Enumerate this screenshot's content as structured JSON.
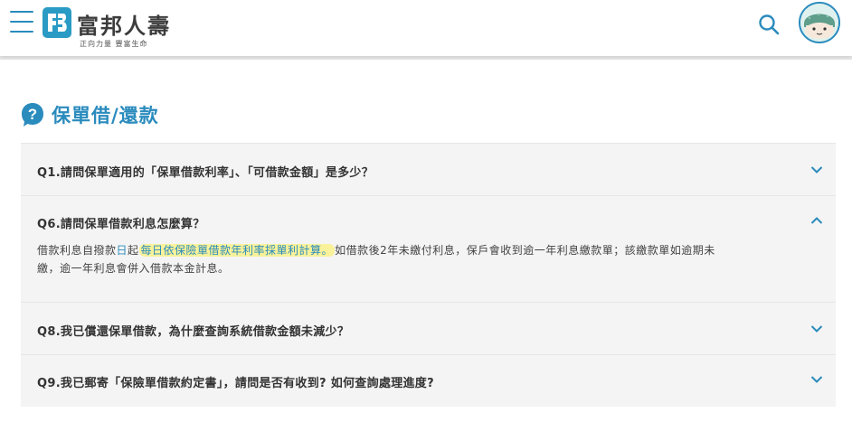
{
  "header": {
    "brand_name": "富邦人壽",
    "slogan": "正向力量 豐富生命",
    "brand_color": "#2a8bbd"
  },
  "section": {
    "title": "保單借/還款"
  },
  "faq": [
    {
      "question": "Q1.請問保單適用的「保單借款利率」、「可借款金額」是多少？",
      "expanded": false
    },
    {
      "question": "Q6.請問保單借款利息怎麼算？",
      "expanded": true,
      "answer": {
        "part1": "借款利息自撥款",
        "part2": "日",
        "part3": "起",
        "highlight": "每日依保險單借款年利率採單利計算。",
        "line1_rest": "如借款後2年未繳付利息，保戶會收到逾一年利息繳款單；該繳款單如逾期未",
        "line2": "繳，逾一年利息會併入借款本金計息。"
      }
    },
    {
      "question": "Q8.我已償還保單借款，為什麼查詢系統借款金額未減少？",
      "expanded": false
    },
    {
      "question": "Q9.我已郵寄「保險單借款約定書」，請問是否有收到? 如何查詢處理進度?",
      "expanded": false
    }
  ]
}
